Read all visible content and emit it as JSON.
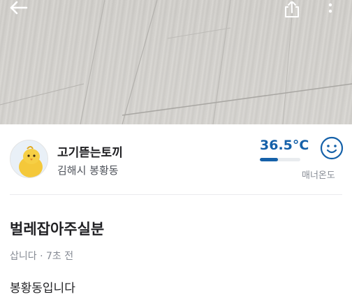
{
  "header": {
    "back_icon": "arrow-left-icon",
    "share_icon": "share-icon",
    "more_icon": "more-vertical-icon"
  },
  "seller": {
    "nickname": "고기뜯는토끼",
    "location": "김해시 봉황동",
    "manner_temperature": "36.5°C",
    "manner_temperature_value": 36.5,
    "manner_label": "매너온도",
    "manner_bar_fraction": 0.45,
    "face_icon": "smile-face-icon"
  },
  "post": {
    "title": "벌레잡아주실분",
    "meta": "삽니다 · 7초 전",
    "body": "봉황동입니다"
  },
  "colors": {
    "manner_blue": "#1561a9",
    "text_primary": "#212124",
    "text_secondary": "#868b94"
  }
}
